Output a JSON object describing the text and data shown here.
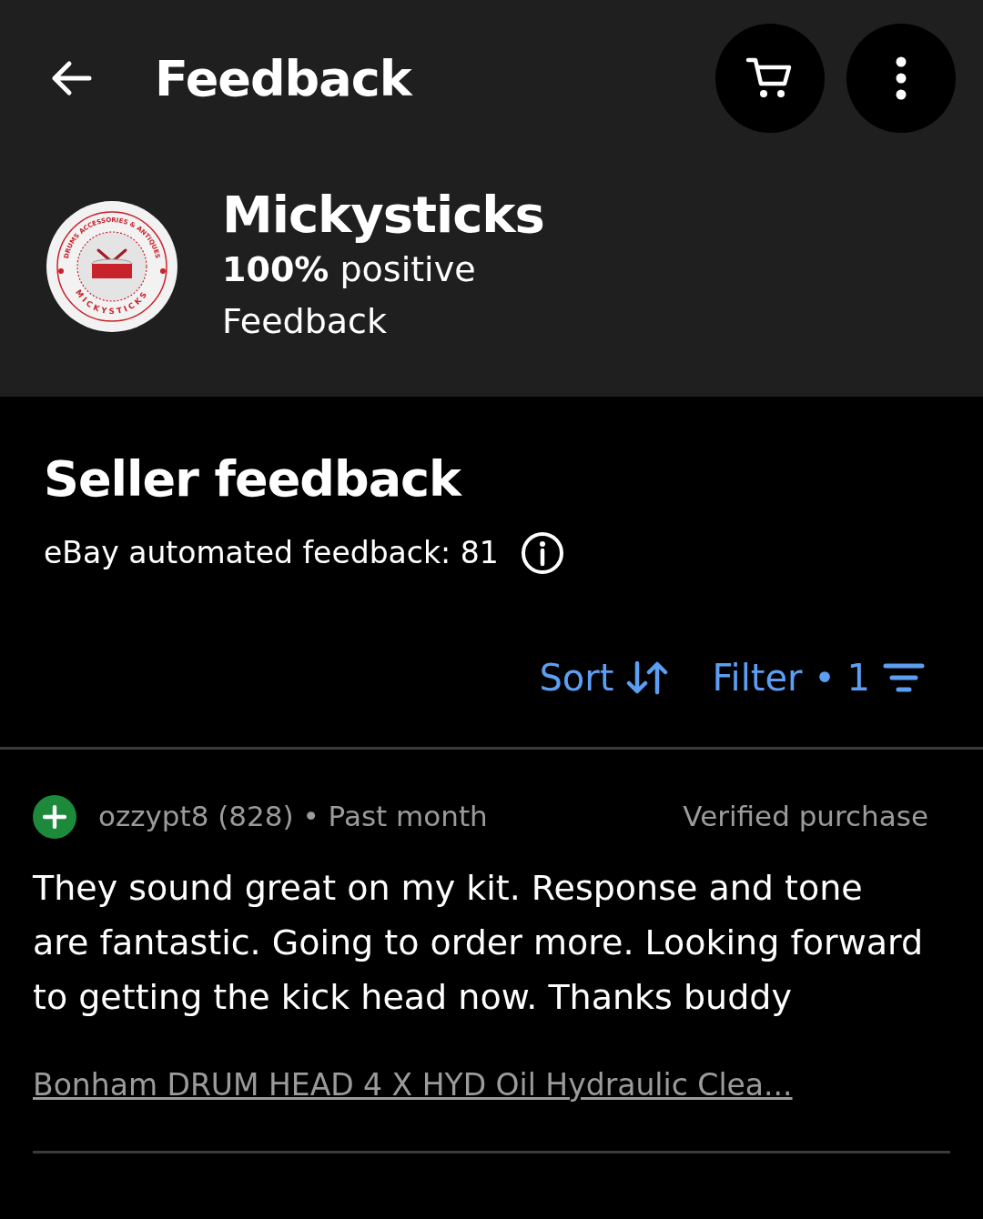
{
  "header": {
    "title": "Feedback"
  },
  "seller": {
    "name": "Mickysticks",
    "rating": "**100%** positive",
    "rating_label": "Feedback",
    "logo_top": "DRUMS ACCESSORIES & ANTIQUES",
    "logo_bottom": "MICKYSTICKS"
  },
  "section": {
    "title": "Seller feedback",
    "automated": "eBay automated feedback: 81"
  },
  "controls": {
    "sort": "Sort",
    "filter": "Filter • 1"
  },
  "entries": [
    {
      "kind": "positive",
      "user": "ozzypt8 (828) • Past month",
      "tag": "Verified purchase",
      "text": "They sound great on my kit. Response and tone are fantastic. Going to order more. Looking forward to getting the kick head now. Thanks buddy",
      "item": "Bonham DRUM HEAD 4 X  HYD Oil Hydraulic Clea..."
    }
  ]
}
